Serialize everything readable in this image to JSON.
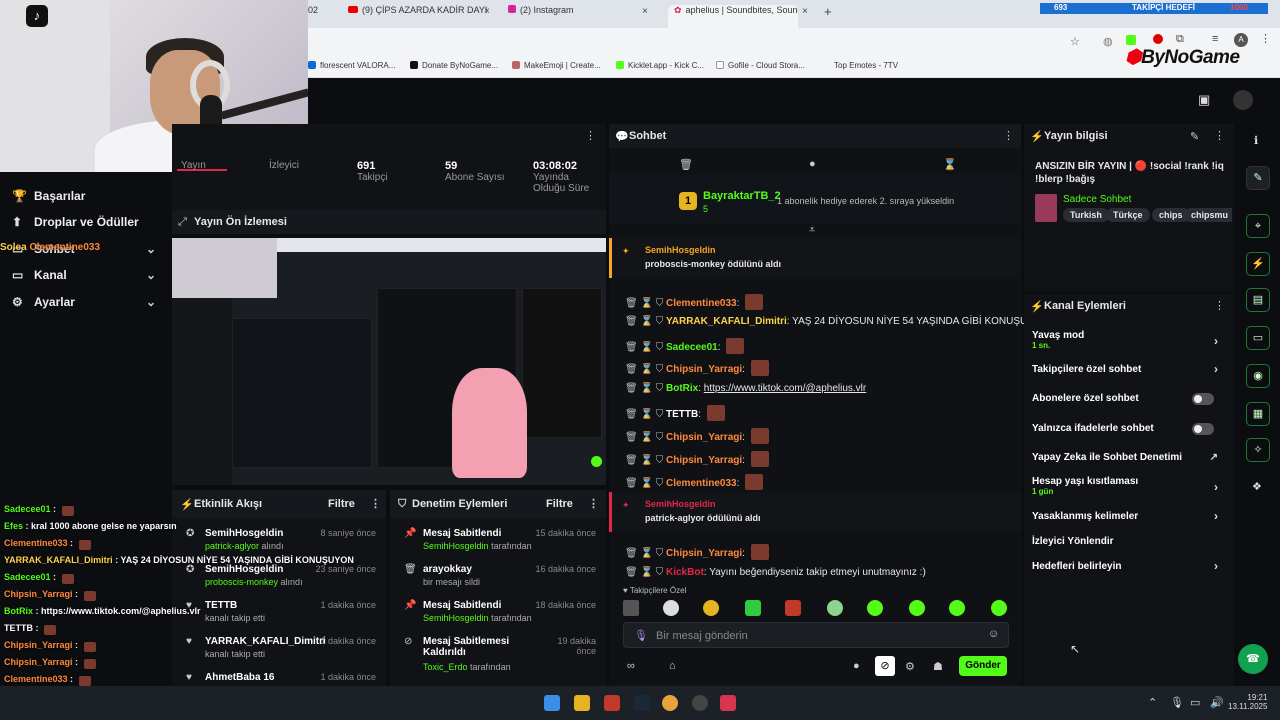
{
  "browser": {
    "tabs": [
      {
        "label": "(9) ÇİPS AZARDA KADİR DAYI"
      },
      {
        "label": "(2) Instagram"
      },
      {
        "label": "aphelius | Soundbites, Sounds"
      }
    ],
    "tab_fragment": "02",
    "bookmarks": [
      "florescent VALORA...",
      "Donate ByNoGame...",
      "MakeEmoji | Create...",
      "Kicklet.app - Kick C...",
      "Gofile - Cloud Stora...",
      "Top Emotes - 7TV"
    ]
  },
  "overlay": {
    "goal_count": "693",
    "goal_label": "TAKİPÇİ HEDEFİ",
    "goal_target": "1000",
    "brand": "ByNoGame",
    "app_icon": "tiktok-icon"
  },
  "sidebar": {
    "items": [
      {
        "label": "Başarılar",
        "icon": "trophy-icon"
      },
      {
        "label": "Droplar ve Ödüller",
        "icon": "gift-icon"
      },
      {
        "label": "Sohbet",
        "icon": "chat-icon"
      },
      {
        "label": "Kanal",
        "icon": "channel-icon"
      },
      {
        "label": "Ayarlar",
        "icon": "gear-icon"
      }
    ],
    "overlap_text": "Solea"
  },
  "stats": {
    "items": [
      {
        "value": "",
        "label": "Yayın"
      },
      {
        "value": "",
        "label": "İzleyici"
      },
      {
        "value": "691",
        "label": "Takipçi"
      },
      {
        "value": "59",
        "label": "Abone Sayısı"
      },
      {
        "value": "03:08:02",
        "label": "Yayında Olduğu Süre"
      }
    ]
  },
  "preview": {
    "title": "Yayın Ön İzlemesi"
  },
  "activity": {
    "title": "Etkinlik Akışı",
    "filter": "Filtre",
    "items": [
      {
        "name": "SemihHosgeldin",
        "sub_user": "patrick-aglyor",
        "sub": "alındı",
        "time": "8 saniye önce"
      },
      {
        "name": "SemihHosgeldin",
        "sub_user": "proboscis-monkey",
        "sub": "alındı",
        "time": "23 saniye önce"
      },
      {
        "name": "TETTB",
        "sub_user": "",
        "sub": "kanalı takip etti",
        "time": "1 dakika önce"
      },
      {
        "name": "YARRAK_KAFALI_Dimitri",
        "sub_user": "",
        "sub": "kanalı takip etti",
        "time": "1 dakika önce"
      },
      {
        "name": "AhmetBaba 16",
        "sub_user": "",
        "sub": "",
        "time": "1 dakika önce"
      }
    ]
  },
  "moderation": {
    "title": "Denetim Eylemleri",
    "filter": "Filtre",
    "items": [
      {
        "name": "Mesaj Sabitlendi",
        "sub_user": "SemihHosgeldin",
        "sub": "tarafından",
        "time": "15 dakika önce"
      },
      {
        "name": "arayokkay",
        "sub_user": "",
        "sub": "bir mesajı sildi",
        "time": "16 dakika önce"
      },
      {
        "name": "Mesaj Sabitlendi",
        "sub_user": "SemihHosgeldin",
        "sub": "tarafından",
        "time": "18 dakika önce"
      },
      {
        "name": "Mesaj Sabitlemesi Kaldırıldı",
        "sub_user": "Toxic_Erdo",
        "sub": "tarafından",
        "time": "19 dakika önce"
      }
    ]
  },
  "chat": {
    "title": "Sohbet",
    "gift": {
      "user": "BayraktarTB_2",
      "count": "5",
      "text": "1 abonelik hediye ederek 2. sıraya yükseldin",
      "rank": "1"
    },
    "reward1": {
      "user": "SemihHosgeldin",
      "text": "proboscis-monkey ödülünü aldı"
    },
    "reward2": {
      "user": "SemihHosgeldin",
      "text": "patrick-aglyor ödülünü aldı"
    },
    "messages": [
      {
        "user": "Clementine033",
        "text": "",
        "color": "#ff8a3d"
      },
      {
        "user": "YARRAK_KAFALI_Dimitri",
        "text": "YAŞ 24 DİYOSUN NİYE 54 YAŞINDA GİBİ KONUŞUYON",
        "color": "#ffd34d"
      },
      {
        "user": "Sadecee01",
        "text": "",
        "color": "#53fc18"
      },
      {
        "user": "Chipsin_Yarragi",
        "text": "",
        "color": "#ff8a3d"
      },
      {
        "user": "BotRix",
        "text": "https://www.tiktok.com/@aphelius.vlr",
        "color": "#53fc18"
      },
      {
        "user": "TETTB",
        "text": "",
        "color": "#ffffff"
      },
      {
        "user": "Chipsin_Yarragi",
        "text": "",
        "color": "#ff8a3d"
      },
      {
        "user": "Chipsin_Yarragi",
        "text": "",
        "color": "#ff8a3d"
      },
      {
        "user": "Clementine033",
        "text": "",
        "color": "#ff8a3d"
      },
      {
        "user": "Chipsin_Yarragi",
        "text": "",
        "color": "#ff8a3d"
      },
      {
        "user": "KickBot",
        "text": "Yayını beğendiyseniz takip etmeyi unutmayınız :)",
        "color": "#e0284a"
      }
    ],
    "follower_only": "Takipçilere Özel",
    "input_placeholder": "Bir mesaj gönderin",
    "send": "Gönder"
  },
  "info": {
    "title": "Yayın bilgisi",
    "stream_title": "ANSIZIN BİR YAYIN | 🔴 !social !rank !iq !blerp !bağış",
    "category": "Sadece Sohbet",
    "tags": [
      "Turkish",
      "Türkçe",
      "chips",
      "chipsmu"
    ]
  },
  "actions": {
    "title": "Kanal Eylemleri",
    "items": [
      {
        "label": "Yavaş mod",
        "sub": "1 sn.",
        "ctrl": "chevron"
      },
      {
        "label": "Takipçilere özel sohbet",
        "sub": "",
        "ctrl": "chevron"
      },
      {
        "label": "Abonelere özel sohbet",
        "sub": "",
        "ctrl": "toggle"
      },
      {
        "label": "Yalnızca ifadelerle sohbet",
        "sub": "",
        "ctrl": "toggle"
      },
      {
        "label": "Yapay Zeka ile Sohbet Denetimi",
        "sub": "",
        "ctrl": "external"
      },
      {
        "label": "Hesap yaşı kısıtlaması",
        "sub": "1 gün",
        "ctrl": "chevron"
      },
      {
        "label": "Yasaklanmış kelimeler",
        "sub": "",
        "ctrl": "chevron"
      },
      {
        "label": "İzleyici Yönlendir",
        "sub": "",
        "ctrl": "none"
      },
      {
        "label": "Hedefleri belirleyin",
        "sub": "",
        "ctrl": "chevron"
      }
    ]
  },
  "overlay_chat": [
    {
      "user": "Sadecee01",
      "text": "",
      "color": "#53fc18"
    },
    {
      "user": "Efes",
      "text": "kral 1000 abone gelse ne yaparsın",
      "color": "#53fc18"
    },
    {
      "user": "Clementine033",
      "text": "",
      "color": "#ff8a3d"
    },
    {
      "user": "YARRAK_KAFALI_Dimitri",
      "text": "YAŞ 24 DİYOSUN NİYE 54 YAŞINDA GİBİ KONUŞUYON",
      "color": "#ffd34d"
    },
    {
      "user": "Sadecee01",
      "text": "",
      "color": "#53fc18"
    },
    {
      "user": "Chipsin_Yarragi",
      "text": "",
      "color": "#ff8a3d"
    },
    {
      "user": "BotRix",
      "text": "https://www.tiktok.com/@aphelius.vlr",
      "color": "#53fc18"
    },
    {
      "user": "TETTB",
      "text": "",
      "color": "#ffffff"
    },
    {
      "user": "Chipsin_Yarragi",
      "text": "",
      "color": "#ff8a3d"
    },
    {
      "user": "Chipsin_Yarragi",
      "text": "",
      "color": "#ff8a3d"
    },
    {
      "user": "Clementine033",
      "text": "",
      "color": "#ff8a3d"
    },
    {
      "user": "Chipsin_Yarragi",
      "text": "",
      "color": "#ff8a3d"
    },
    {
      "user": "KickBot",
      "text": "Yayını beğendiyseniz takip etmeyi unutmayınız :)",
      "color": "#e0284a"
    }
  ],
  "overlay_sidebar_name": "Clementine033",
  "taskbar": {
    "time": "19:21",
    "date": "13.11.2025"
  }
}
